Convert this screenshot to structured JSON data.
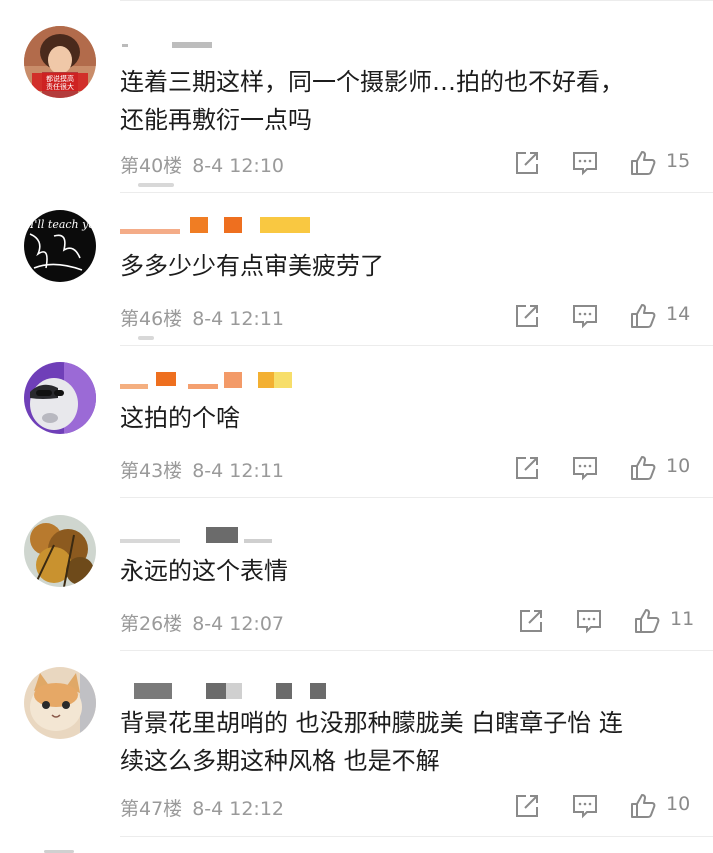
{
  "comments": [
    {
      "floor": "第40楼",
      "time": "8-4 12:10",
      "text": "连着三期这样，同一个摄影师…拍的也不好看，\n还能再敷衍一点吗",
      "likes": "15",
      "avatar_caption_line1": "都说摸高",
      "avatar_caption_line2": "责任很大"
    },
    {
      "floor": "第46楼",
      "time": "8-4 12:11",
      "text": "多多少少有点审美疲劳了",
      "likes": "14",
      "avatar_text": "I'll teach you how to fuck."
    },
    {
      "floor": "第43楼",
      "time": "8-4 12:11",
      "text": "这拍的个啥",
      "likes": "10"
    },
    {
      "floor": "第26楼",
      "time": "8-4 12:07",
      "text": "永远的这个表情",
      "likes": "11"
    },
    {
      "floor": "第47楼",
      "time": "8-4 12:12",
      "text": "背景花里胡哨的 也没那种朦胧美 白瞎章子怡 连\n续这么多期这种风格 也是不解",
      "likes": "10"
    }
  ],
  "icons": {
    "share": "share-icon",
    "reply": "comment-icon",
    "like": "thumbs-up-icon"
  },
  "colors": {
    "meta_text": "#9a9a9a",
    "icon": "#8a8a8a",
    "divider": "#ececec",
    "username_orange": "#f07d23",
    "username_yellow": "#f9c841",
    "username_gray": "#6b6b6b"
  }
}
